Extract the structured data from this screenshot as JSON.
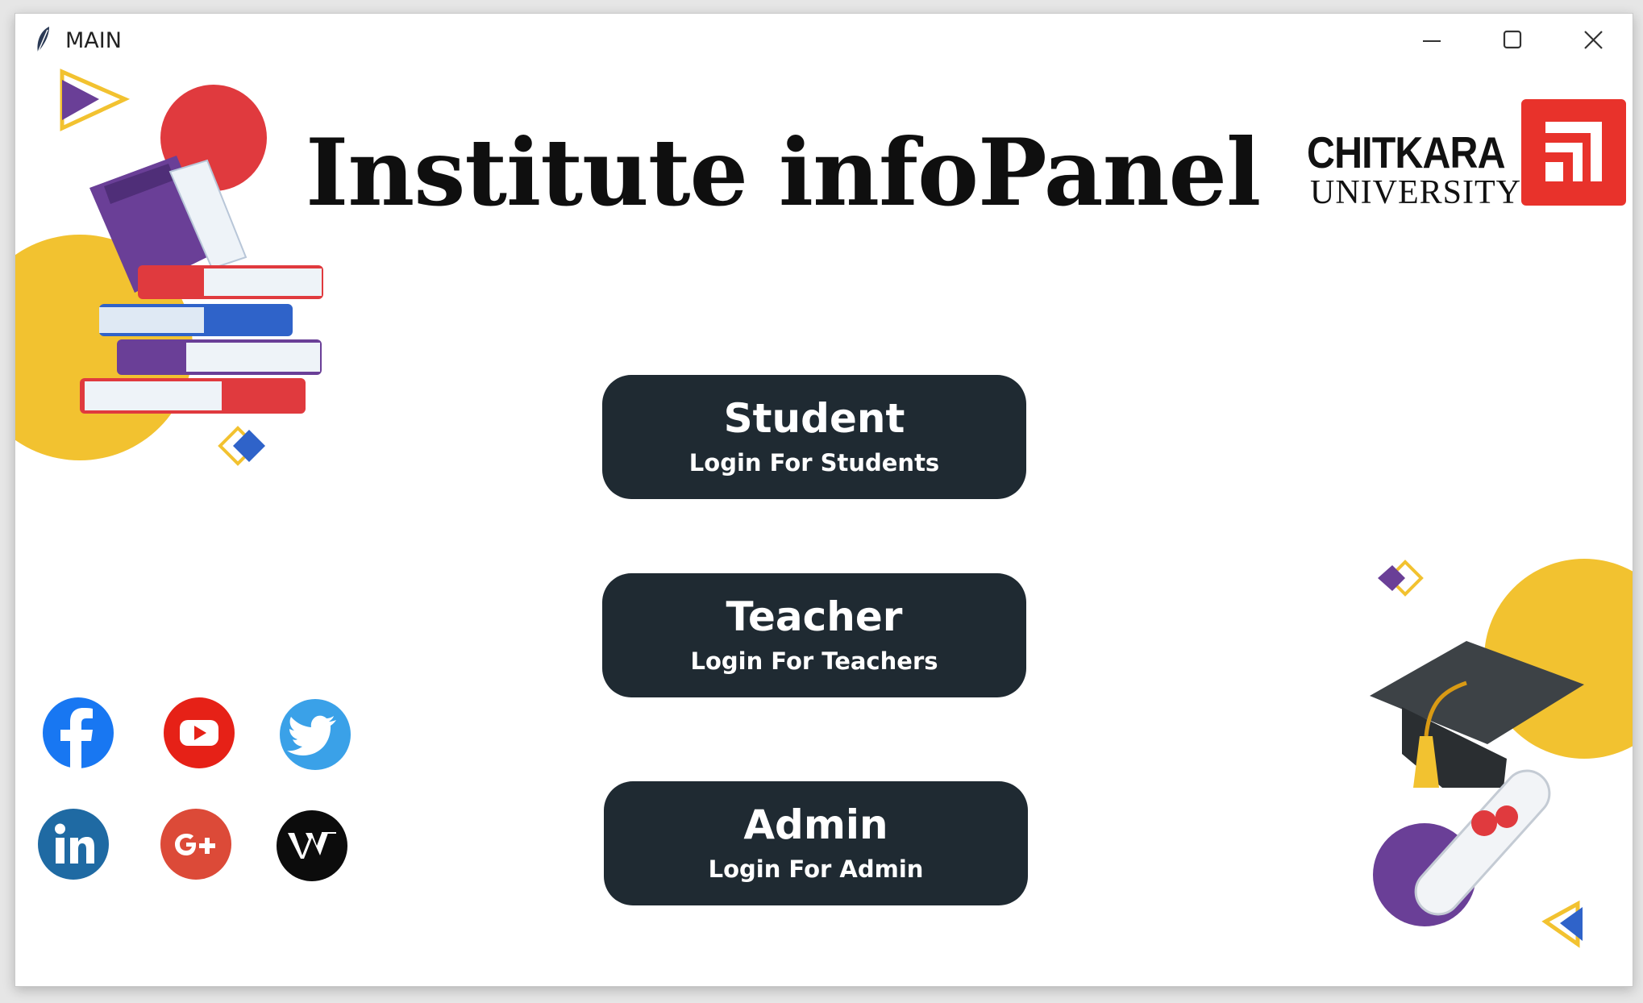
{
  "window": {
    "title": "MAIN",
    "controls": [
      "minimize-icon",
      "maximize-icon",
      "close-icon"
    ]
  },
  "main": {
    "heading": "Institute infoPanel"
  },
  "logo": {
    "name": "CHITKARA",
    "subtitle": "UNIVERSITY",
    "brand_color": "#e8322b"
  },
  "buttons": {
    "student": {
      "title": "Student",
      "subtitle": "Login For Students"
    },
    "teacher": {
      "title": "Teacher",
      "subtitle": "Login For Teachers"
    },
    "admin": {
      "title": "Admin",
      "subtitle": "Login For Admin"
    },
    "background_color": "#1f2a32"
  },
  "social": [
    "facebook-icon",
    "youtube-icon",
    "twitter-icon",
    "linkedin-icon",
    "google-plus-icon",
    "wikipedia-icon"
  ],
  "colors": {
    "accent_yellow": "#f2c230",
    "accent_purple": "#6a3f97",
    "accent_red": "#e03a3e",
    "accent_blue": "#2f63c9"
  }
}
